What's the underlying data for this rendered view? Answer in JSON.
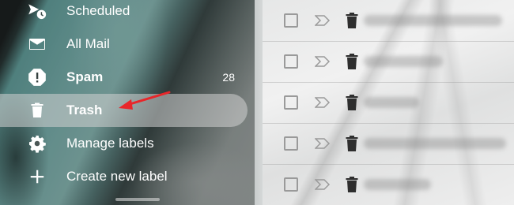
{
  "sidebar": {
    "items": [
      {
        "label": "Scheduled",
        "icon": "scheduled-icon"
      },
      {
        "label": "All Mail",
        "icon": "mail-icon"
      },
      {
        "label": "Spam",
        "icon": "report-spam-icon",
        "count": "28"
      },
      {
        "label": "Trash",
        "icon": "trash-icon"
      },
      {
        "label": "Manage labels",
        "icon": "gear-icon"
      },
      {
        "label": "Create new label",
        "icon": "plus-icon"
      }
    ]
  },
  "annotation": {
    "arrow_color": "#e8262a"
  },
  "message_list": {
    "row_count": 5
  }
}
